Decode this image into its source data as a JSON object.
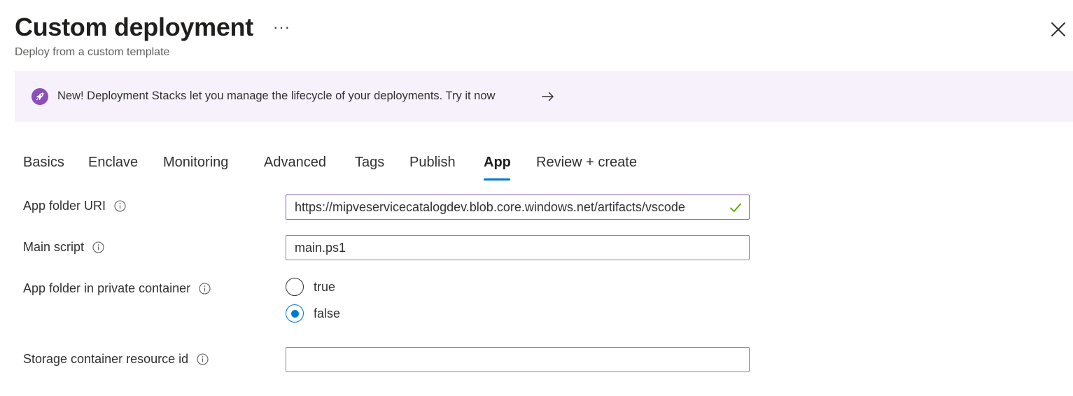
{
  "header": {
    "title": "Custom deployment",
    "more_label": "···",
    "subtitle": "Deploy from a custom template"
  },
  "banner": {
    "text": "New! Deployment Stacks let you manage the lifecycle of your deployments. Try it now",
    "icon": "rocket-icon",
    "accent_color": "#8a4fb8"
  },
  "tabs": [
    {
      "label": "Basics"
    },
    {
      "label": "Enclave"
    },
    {
      "label": "Monitoring"
    },
    {
      "label": "Advanced"
    },
    {
      "label": "Tags"
    },
    {
      "label": "Publish"
    },
    {
      "label": "App",
      "active": true
    },
    {
      "label": "Review + create"
    }
  ],
  "form": {
    "app_folder_uri": {
      "label": "App folder URI",
      "value": "https://mipveservicecatalogdev.blob.core.windows.net/artifacts/vscode",
      "status_icon": "check-icon"
    },
    "main_script": {
      "label": "Main script",
      "value": "main.ps1"
    },
    "private_container": {
      "label": "App folder in private container",
      "options": [
        {
          "label": "true",
          "selected": false
        },
        {
          "label": "false",
          "selected": true
        }
      ]
    },
    "storage_container": {
      "label": "Storage container resource id",
      "value": ""
    }
  },
  "colors": {
    "accent": "#0078d4",
    "valid_border": "#8764b8",
    "check": "#57a300",
    "banner_bg": "#f6f1fa"
  }
}
